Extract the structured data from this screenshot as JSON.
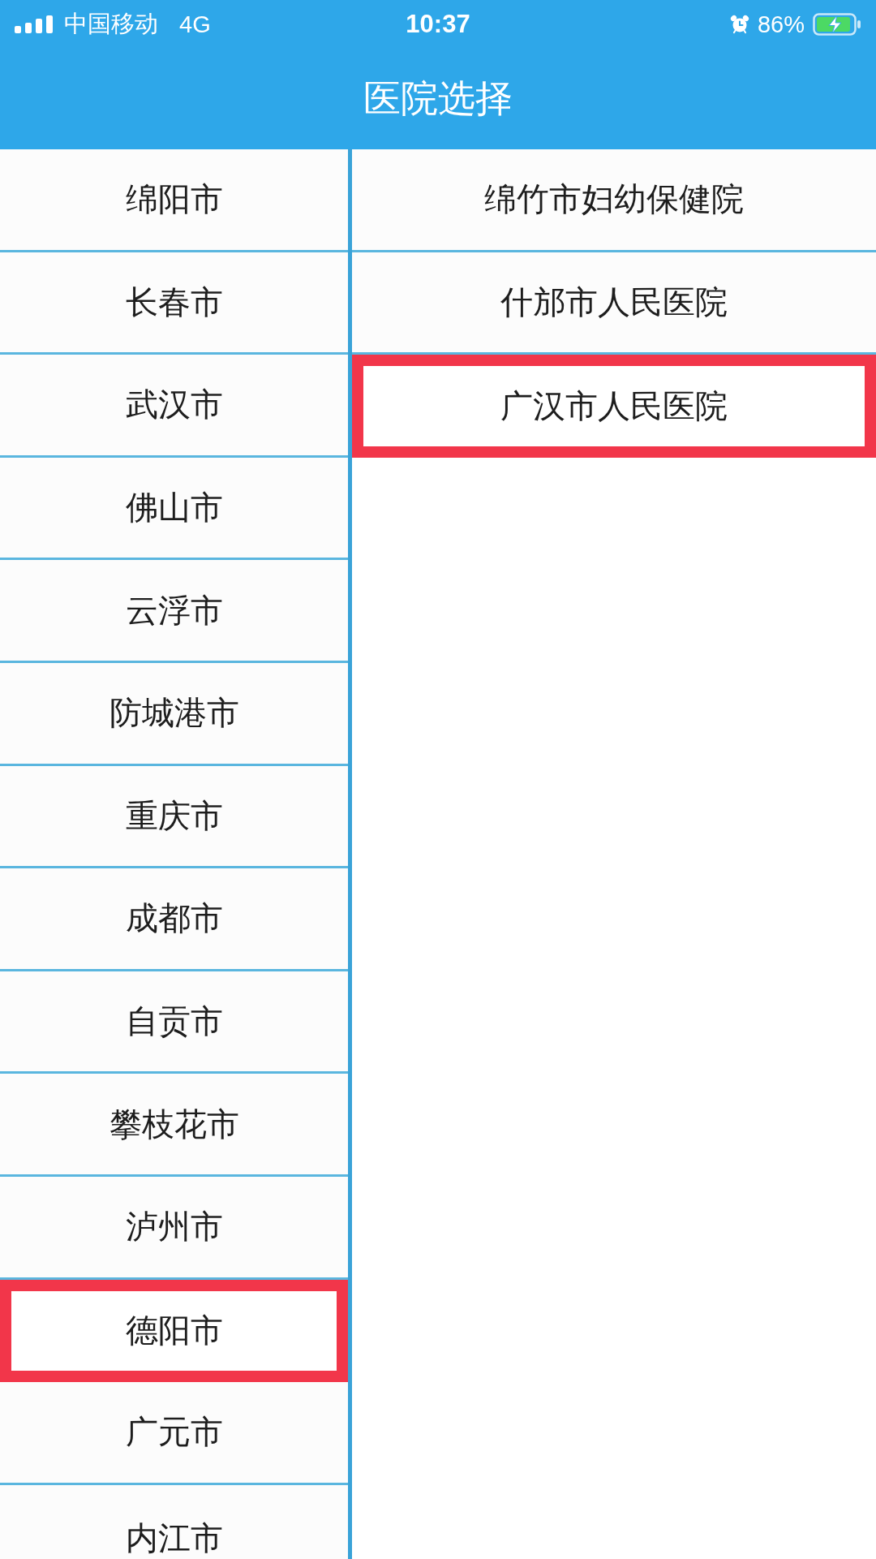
{
  "status_bar": {
    "carrier": "中国移动",
    "network": "4G",
    "time": "10:37",
    "battery": "86%",
    "charging": true
  },
  "header": {
    "title": "医院选择"
  },
  "cities": [
    {
      "name": "绵阳市",
      "selected": false
    },
    {
      "name": "长春市",
      "selected": false
    },
    {
      "name": "武汉市",
      "selected": false
    },
    {
      "name": "佛山市",
      "selected": false
    },
    {
      "name": "云浮市",
      "selected": false
    },
    {
      "name": "防城港市",
      "selected": false
    },
    {
      "name": "重庆市",
      "selected": false
    },
    {
      "name": "成都市",
      "selected": false
    },
    {
      "name": "自贡市",
      "selected": false
    },
    {
      "name": "攀枝花市",
      "selected": false
    },
    {
      "name": "泸州市",
      "selected": false
    },
    {
      "name": "德阳市",
      "selected": true
    },
    {
      "name": "广元市",
      "selected": false
    },
    {
      "name": "内江市",
      "selected": false
    }
  ],
  "hospitals": [
    {
      "name": "绵竹市妇幼保健院",
      "selected": false
    },
    {
      "name": "什邡市人民医院",
      "selected": false
    },
    {
      "name": "广汉市人民医院",
      "selected": true
    }
  ]
}
